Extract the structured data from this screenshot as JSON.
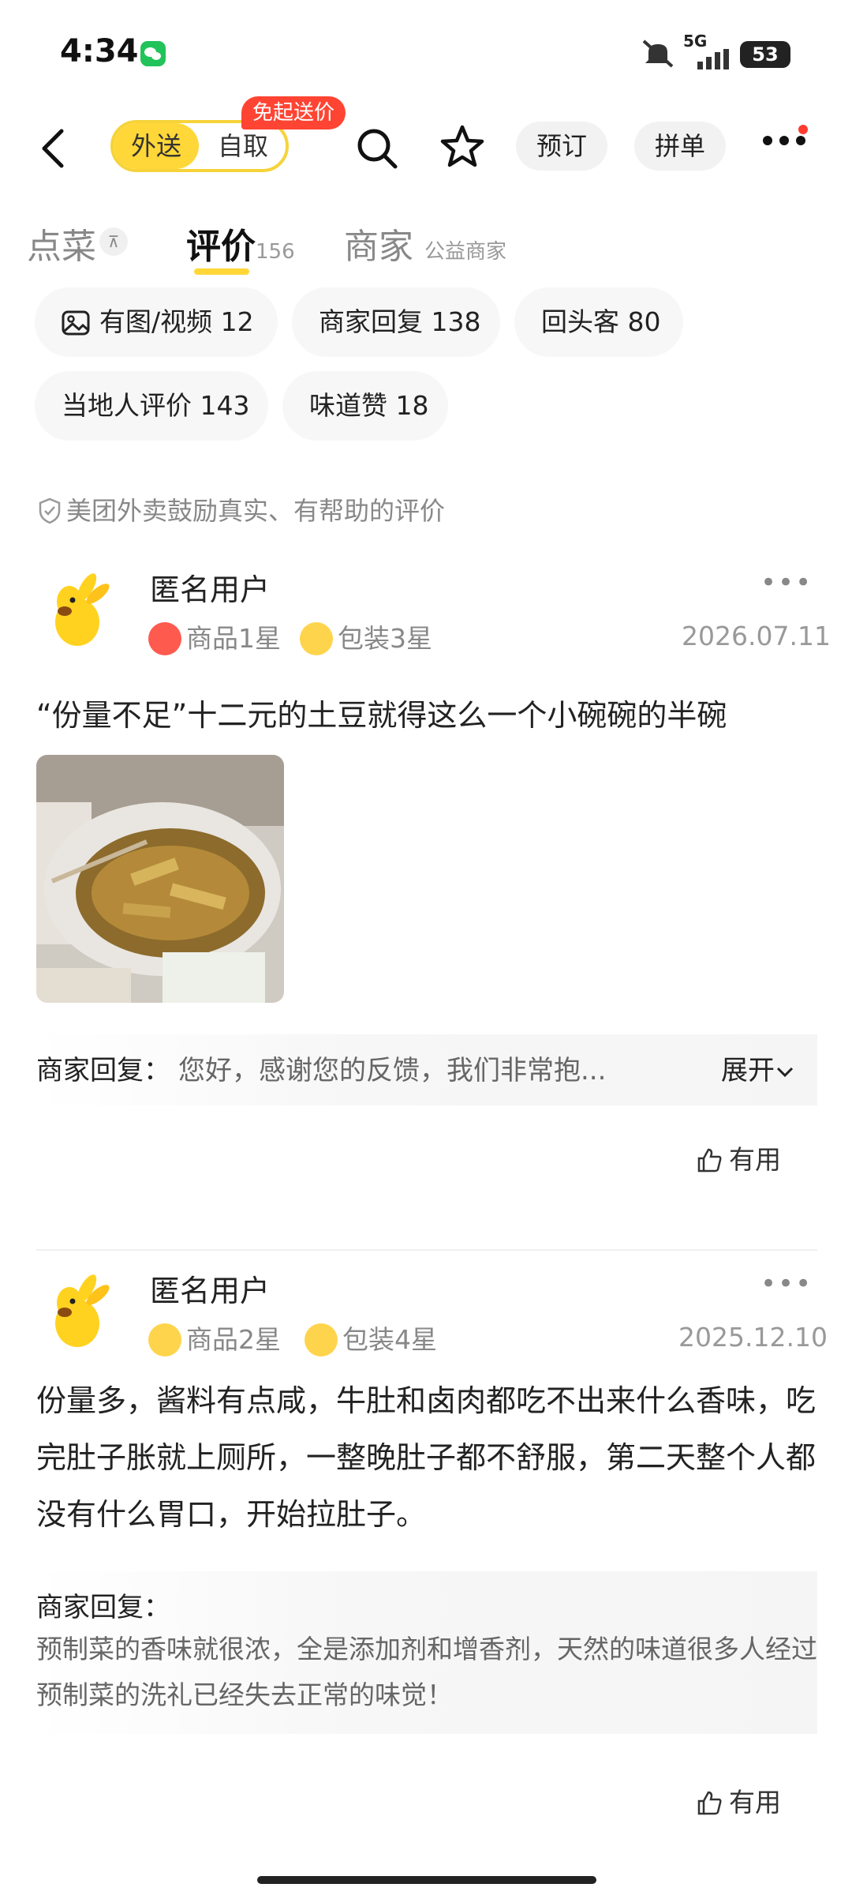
{
  "status_bar": {
    "time": "4:34",
    "network": "5G",
    "battery": "53"
  },
  "nav": {
    "mode_deliver": "外送",
    "mode_pickup": "自取",
    "promo_badge": "免起送价",
    "reserve_button": "预订",
    "group_button": "拼单"
  },
  "tabs": {
    "order": "点菜",
    "reviews": "评价",
    "reviews_count": "156",
    "merchant": "商家",
    "merchant_sub": "公益商家"
  },
  "filters": [
    "有图/视频 12",
    "商家回复 138",
    "回头客 80",
    "当地人评价 143",
    "味道赞 18"
  ],
  "notice": "美团外卖鼓励真实、有帮助的评价",
  "reviews": [
    {
      "user": "匿名用户",
      "product_rating": "商品1星",
      "package_rating": "包装3星",
      "date": "2026.07.11",
      "text": "“份量不足”十二元的土豆就得这么一个小碗碗的半碗",
      "reply_label": "商家回复：",
      "reply_text": "您好，感谢您的反馈，我们非常抱...",
      "expand": "展开",
      "useful": "有用"
    },
    {
      "user": "匿名用户",
      "product_rating": "商品2星",
      "package_rating": "包装4星",
      "date": "2025.12.10",
      "text": "份量多，酱料有点咸，牛肚和卤肉都吃不出来什么香味，吃完肚子胀就上厕所，一整晚肚子都不舒服，第二天整个人都没有什么胃口，开始拉肚子。",
      "reply_label": "商家回复：",
      "reply_text": "预制菜的香味就很浓，全是添加剂和增香剂，天然的味道很多人经过预制菜的洗礼已经失去正常的味觉！",
      "useful": "有用"
    }
  ],
  "colors": {
    "accent_yellow": "#ffd738",
    "badge_red": "#ff4433"
  }
}
